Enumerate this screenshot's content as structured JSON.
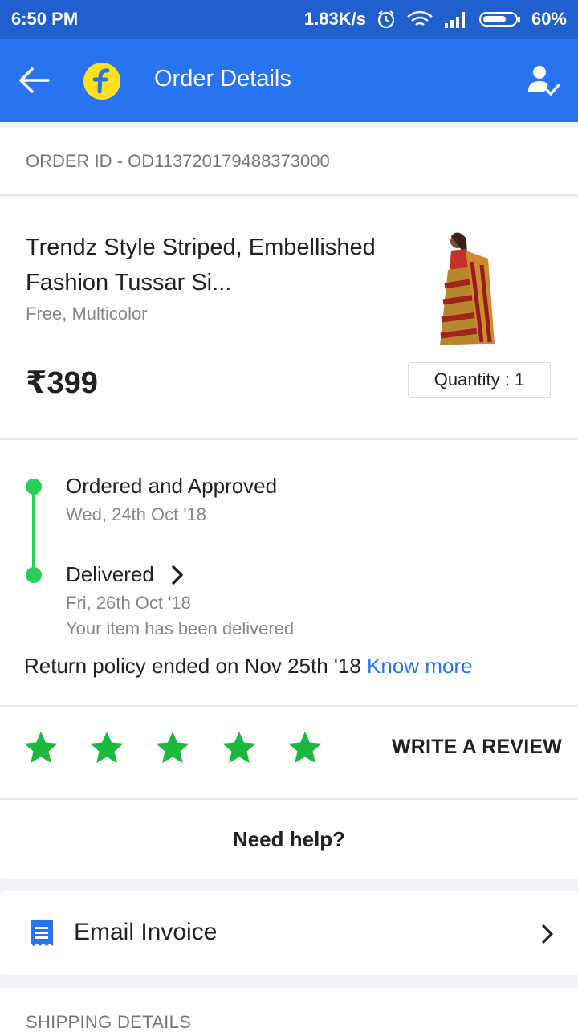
{
  "status_bar": {
    "time": "6:50 PM",
    "network_speed": "1.83K/s",
    "battery": "60%",
    "icons": [
      "alarm-icon",
      "wifi-icon",
      "signal-icon",
      "battery-icon"
    ]
  },
  "app_bar": {
    "title": "Order Details",
    "background": "#2874f0",
    "icons": [
      "back-arrow-icon",
      "flipkart-logo",
      "account-check-icon"
    ]
  },
  "order": {
    "id_text": "ORDER ID - OD113720179488373000"
  },
  "product": {
    "title": "Trendz Style Striped, Embellished Fashion Tussar Si...",
    "subtitle": "Free, Multicolor",
    "price": "₹399",
    "quantity": "Quantity : 1"
  },
  "tracking": {
    "steps": [
      {
        "label": "Ordered and Approved",
        "date": "Wed, 24th Oct '18",
        "note": ""
      },
      {
        "label": "Delivered",
        "date": "Fri, 26th Oct '18",
        "note": "Your item has been delivered"
      }
    ],
    "accent": "#26d055",
    "return_policy": "Return policy ended on Nov 25th '18",
    "know_more": "Know more"
  },
  "rating": {
    "stars_filled": 5,
    "stars_total": 5,
    "star_color": "#1db83e",
    "write_review": "WRITE A REVIEW"
  },
  "help": {
    "label": "Need help?"
  },
  "email_invoice": {
    "label": "Email Invoice",
    "icon": "invoice-icon"
  },
  "shipping": {
    "label": "SHIPPING DETAILS"
  }
}
